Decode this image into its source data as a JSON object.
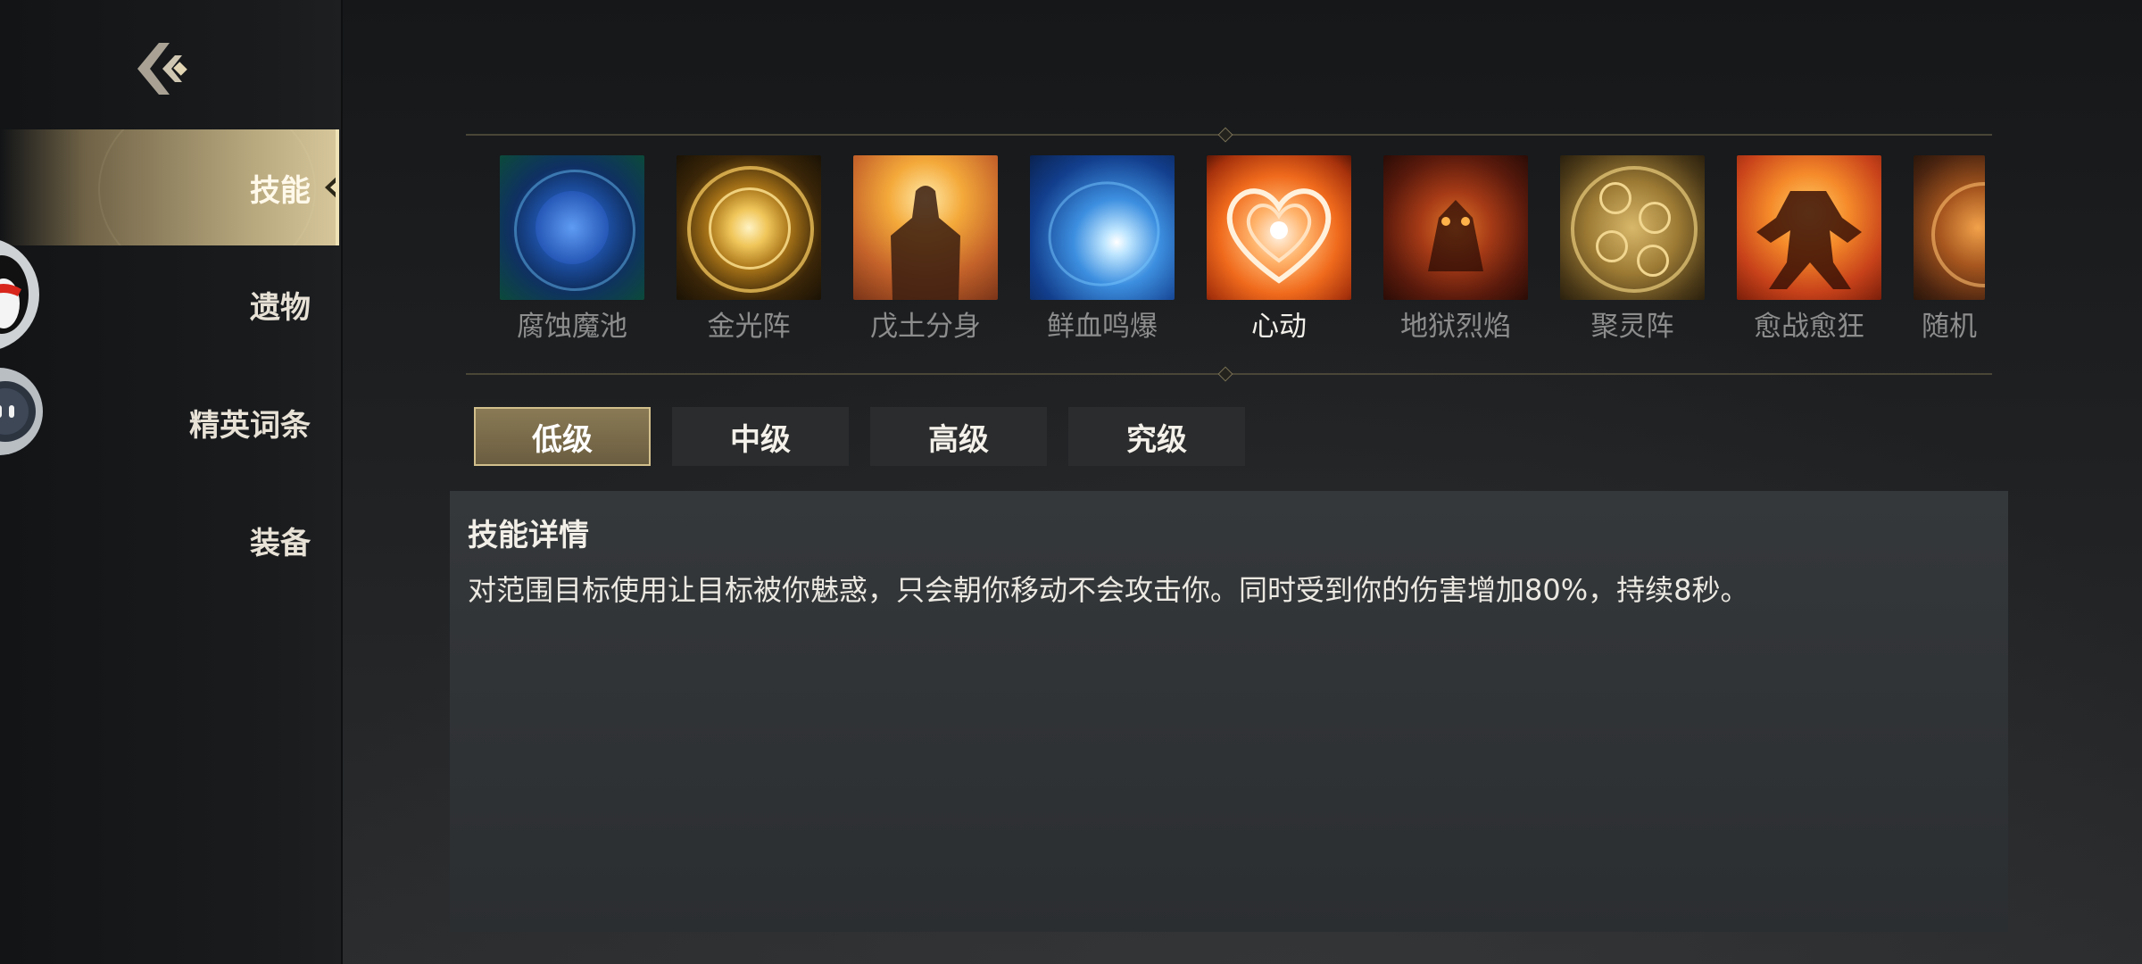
{
  "sidebar": {
    "back_icon": "back-chevron-icon",
    "items": [
      {
        "label": "技能",
        "active": true
      },
      {
        "label": "遗物",
        "active": false
      },
      {
        "label": "精英词条",
        "active": false
      },
      {
        "label": "装备",
        "active": false
      }
    ]
  },
  "skills": [
    {
      "name": "腐蚀魔池",
      "active": false,
      "icon": "corrosion-pool-icon"
    },
    {
      "name": "金光阵",
      "active": false,
      "icon": "golden-array-icon"
    },
    {
      "name": "戊土分身",
      "active": false,
      "icon": "earth-clone-icon"
    },
    {
      "name": "鲜血鸣爆",
      "active": false,
      "icon": "blood-burst-icon"
    },
    {
      "name": "心动",
      "active": true,
      "icon": "heart-icon"
    },
    {
      "name": "地狱烈焰",
      "active": false,
      "icon": "hellfire-icon"
    },
    {
      "name": "聚灵阵",
      "active": false,
      "icon": "spirit-array-icon"
    },
    {
      "name": "愈战愈狂",
      "active": false,
      "icon": "berserk-icon"
    },
    {
      "name": "随机",
      "active": false,
      "icon": "random-icon"
    }
  ],
  "tiers": [
    {
      "label": "低级",
      "active": true
    },
    {
      "label": "中级",
      "active": false
    },
    {
      "label": "高级",
      "active": false
    },
    {
      "label": "究级",
      "active": false
    }
  ],
  "detail": {
    "title": "技能详情",
    "description": "对范围目标使用让目标被你魅惑，只会朝你移动不会攻击你。同时受到你的伤害增加80%，持续8秒。"
  },
  "colors": {
    "accent_gold": "#d2bf8c",
    "active_text": "#f3f0ea",
    "inactive_text": "#8d8d8d"
  }
}
